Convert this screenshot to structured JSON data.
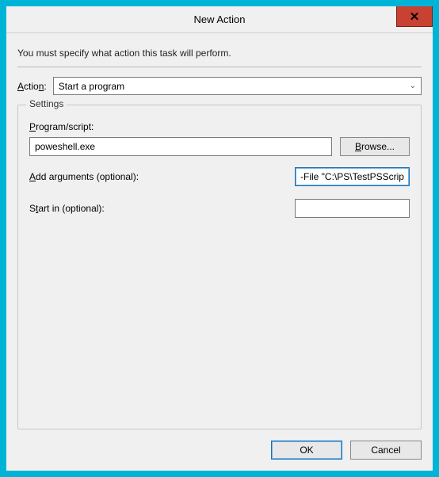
{
  "window": {
    "title": "New Action",
    "close_glyph": "✕"
  },
  "intro": "You must specify what action this task will perform.",
  "action": {
    "label": "Action:",
    "selected": "Start a program"
  },
  "settings": {
    "group_title": "Settings",
    "program_label": "Program/script:",
    "program_value": "poweshell.exe",
    "browse_label": "Browse...",
    "args_label": "Add arguments (optional):",
    "args_value": "-File \"C:\\PS\\TestPSScript",
    "startin_label": "Start in (optional):",
    "startin_value": ""
  },
  "buttons": {
    "ok": "OK",
    "cancel": "Cancel"
  }
}
